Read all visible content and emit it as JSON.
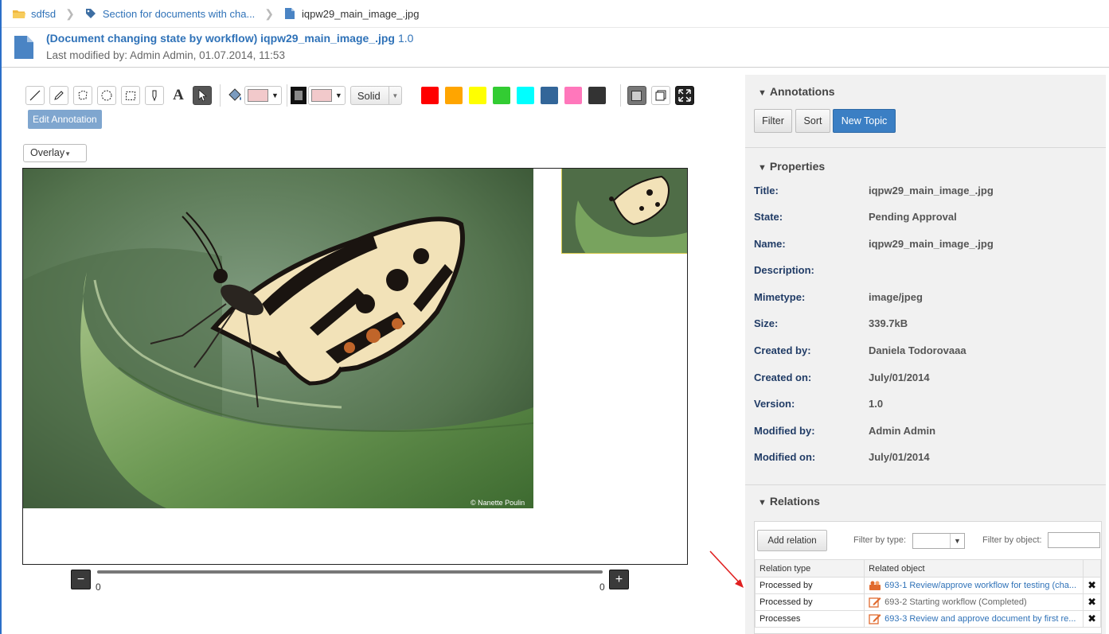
{
  "breadcrumb": {
    "items": [
      {
        "label": "sdfsd",
        "icon": "folder-icon"
      },
      {
        "label": "Section for documents with cha...",
        "icon": "tag-icon"
      },
      {
        "label": "iqpw29_main_image_.jpg",
        "icon": "document-icon"
      }
    ]
  },
  "header": {
    "title": "(Document changing state by workflow) iqpw29_main_image_.jpg",
    "version": "1.0",
    "modified": "Last modified by: Admin Admin, 01.07.2014, 11:53"
  },
  "toolbar": {
    "tools": [
      "line-tool-icon",
      "pencil-tool-icon",
      "polygon-tool-icon",
      "ellipse-tool-icon",
      "rectangle-tool-icon",
      "pin-tool-icon",
      "text-tool-icon",
      "select-tool-icon"
    ],
    "fill_color": "#f2c9cb",
    "stroke_color": "#f2c9cb",
    "line_style": "Solid",
    "palette": [
      "#ff0000",
      "#ffa500",
      "#ffff00",
      "#33cc33",
      "#00ffff",
      "#336699",
      "#ff77bb",
      "#333333"
    ],
    "edit_annotation_label": "Edit Annotation"
  },
  "viewer": {
    "overlay_label": "Overlay",
    "copyright": "© Nanette Poulin",
    "zoom_min": "0",
    "zoom_max": "0",
    "zoom_out": "−",
    "zoom_in": "+"
  },
  "annotations": {
    "title": "Annotations",
    "filter_label": "Filter",
    "sort_label": "Sort",
    "new_topic_label": "New Topic"
  },
  "properties": {
    "title": "Properties",
    "rows": [
      {
        "label": "Title:",
        "value": "iqpw29_main_image_.jpg"
      },
      {
        "label": "State:",
        "value": "Pending Approval"
      },
      {
        "label": "Name:",
        "value": "iqpw29_main_image_.jpg"
      },
      {
        "label": "Description:",
        "value": ""
      },
      {
        "label": "Mimetype:",
        "value": "image/jpeg"
      },
      {
        "label": "Size:",
        "value": "339.7kB"
      },
      {
        "label": "Created by:",
        "value": "Daniela Todorovaaa"
      },
      {
        "label": "Created on:",
        "value": "July/01/2014"
      },
      {
        "label": "Version:",
        "value": "1.0"
      },
      {
        "label": "Modified by:",
        "value": "Admin Admin"
      },
      {
        "label": "Modified on:",
        "value": "July/01/2014"
      }
    ]
  },
  "relations": {
    "title": "Relations",
    "add_label": "Add relation",
    "filter_type_label": "Filter by type:",
    "filter_object_label": "Filter by object:",
    "columns": [
      "Relation type",
      "Related object"
    ],
    "rows": [
      {
        "type": "Processed by",
        "object": "693-1 Review/approve workflow for testing (cha...",
        "icon": "workflow-icon"
      },
      {
        "type": "Processed by",
        "object": "693-2 Starting workflow (Completed)",
        "icon": "edit-task-icon"
      },
      {
        "type": "Processes",
        "object": "693-3 Review and approve document by first re...",
        "icon": "edit-task-icon"
      }
    ]
  }
}
